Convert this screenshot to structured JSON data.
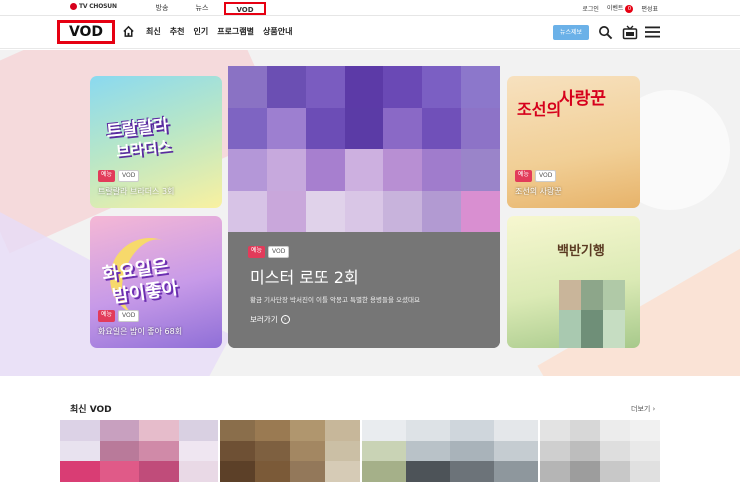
{
  "topbar": {
    "brand": "TV CHOSUN",
    "nav": [
      "방송",
      "뉴스",
      "VOD"
    ],
    "util": [
      "로그인",
      "이벤트",
      "편성표"
    ],
    "event_count": "0"
  },
  "mainnav": {
    "logo": "VOD",
    "menu": [
      "최신",
      "추천",
      "인기",
      "프로그램별",
      "상품안내"
    ],
    "subscribe": "뉴스제보"
  },
  "hero": {
    "cards": [
      {
        "genre": "예능",
        "vod": "VOD",
        "title": "트랄랄라 브라더스 3회",
        "art_line1": "트랄랄라",
        "art_line2": "브라더스"
      },
      {
        "genre": "예능",
        "vod": "VOD",
        "title": "화요일은 밤이 좋아 68회",
        "art_line1": "화요일은",
        "art_line2": "밤이좋아"
      },
      {
        "genre": "예능",
        "vod": "VOD",
        "title": "조선의 사랑꾼",
        "art_line1": "조선의",
        "art_line2": "사랑꾼"
      },
      {
        "art_line1": "백반기행"
      }
    ],
    "center": {
      "genre": "예능",
      "vod": "VOD",
      "title": "미스터 로또 2회",
      "desc": "황금 기사단장 박서진이 이틀 악몽고 특별한 용병들을 오셨대요",
      "more": "보러가기"
    }
  },
  "latest": {
    "title": "최신 VOD",
    "more": "더보기 ›"
  },
  "colors": {
    "accent_red": "#e60012",
    "subscribe_blue": "#6bb1e8",
    "genre_tag": "#e23b5a"
  }
}
